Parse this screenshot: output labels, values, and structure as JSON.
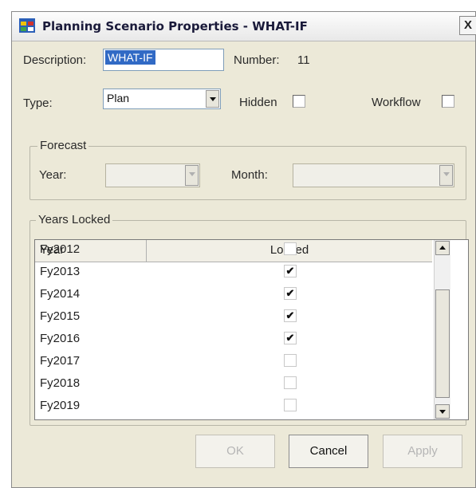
{
  "window": {
    "title": "Planning Scenario Properties - WHAT-IF",
    "close_label": "X"
  },
  "form": {
    "description_label": "Description:",
    "description_value": "WHAT-IF",
    "number_label": "Number:",
    "number_value": "11",
    "type_label": "Type:",
    "type_value": "Plan",
    "hidden_label": "Hidden",
    "hidden_checked": false,
    "workflow_label": "Workflow",
    "workflow_checked": false
  },
  "forecast": {
    "group_title": "Forecast",
    "year_label": "Year:",
    "year_value": "",
    "month_label": "Month:",
    "month_value": ""
  },
  "years_locked": {
    "group_title": "Years Locked",
    "columns": [
      "Year",
      "Locked"
    ],
    "rows": [
      {
        "year": "Fy2012",
        "locked": false
      },
      {
        "year": "Fy2013",
        "locked": true
      },
      {
        "year": "Fy2014",
        "locked": true
      },
      {
        "year": "Fy2015",
        "locked": true
      },
      {
        "year": "Fy2016",
        "locked": true
      },
      {
        "year": "Fy2017",
        "locked": false
      },
      {
        "year": "Fy2018",
        "locked": false
      },
      {
        "year": "Fy2019",
        "locked": false
      }
    ]
  },
  "buttons": {
    "ok_label": "OK",
    "cancel_label": "Cancel",
    "apply_label": "Apply"
  },
  "colors": {
    "dialog_bg": "#ece9d8",
    "selection": "#316ac5"
  }
}
